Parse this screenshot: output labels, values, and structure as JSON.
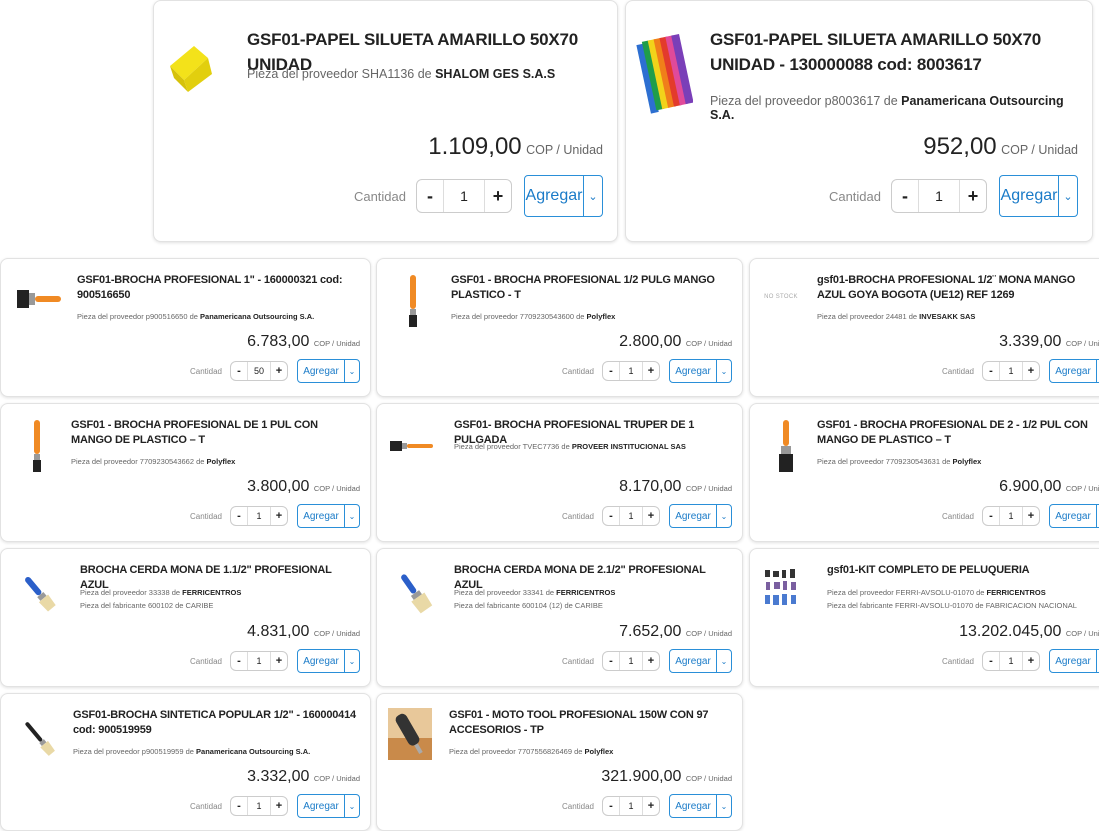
{
  "products": [
    {
      "title": "GSF01-PAPEL SILUETA AMARILLO 50X70 UNIDAD",
      "supplier_prefix": "Pieza del proveedor SHA1136 de ",
      "supplier_name": "SHALOM GES S.A.S",
      "price": "1.109,00",
      "unit": "COP / Unidad",
      "qty_label": "Cantidad",
      "quantity": "1",
      "add_label": "Agregar",
      "icon": "yellow-paper-icon"
    },
    {
      "title": "GSF01-PAPEL SILUETA AMARILLO 50X70 UNIDAD - 130000088 cod: 8003617",
      "supplier_prefix": "Pieza del proveedor p8003617 de ",
      "supplier_name": "Panamericana Outsourcing S.A.",
      "price": "952,00",
      "unit": "COP / Unidad",
      "qty_label": "Cantidad",
      "quantity": "1",
      "add_label": "Agregar",
      "icon": "colored-paper-stack-icon"
    },
    {
      "title": "GSF01-BROCHA PROFESIONAL 1\" - 160000321 cod: 900516650",
      "supplier_prefix": "Pieza del proveedor p900516650 de ",
      "supplier_name": "Panamericana Outsourcing S.A.",
      "price": "6.783,00",
      "unit": "COP / Unidad",
      "qty_label": "Cantidad",
      "quantity": "50",
      "add_label": "Agregar",
      "icon": "paintbrush-icon"
    },
    {
      "title": "GSF01 - BROCHA PROFESIONAL 1/2 PULG MANGO PLASTICO - T",
      "supplier_prefix": "Pieza del proveedor 7709230543600 de ",
      "supplier_name": "Polyflex",
      "price": "2.800,00",
      "unit": "COP / Unidad",
      "qty_label": "Cantidad",
      "quantity": "1",
      "add_label": "Agregar",
      "icon": "paintbrush-icon"
    },
    {
      "title": "gsf01-BROCHA PROFESIONAL 1/2¨ MONA MANGO AZUL GOYA BOGOTA (UE12) REF 1269",
      "supplier_prefix": "Pieza del proveedor 24481 de ",
      "supplier_name": "INVESAKK SAS",
      "price": "3.339,00",
      "unit": "COP / Unidad",
      "qty_label": "Cantidad",
      "quantity": "1",
      "add_label": "Agregar",
      "no_stock": "NO STOCK",
      "icon": "no-stock-icon"
    },
    {
      "title": "GSF01 - BROCHA PROFESIONAL DE 1 PUL CON MANGO DE PLASTICO – T",
      "supplier_prefix": "Pieza del proveedor 7709230543662 de ",
      "supplier_name": "Polyflex",
      "price": "3.800,00",
      "unit": "COP / Unidad",
      "qty_label": "Cantidad",
      "quantity": "1",
      "add_label": "Agregar",
      "icon": "paintbrush-icon"
    },
    {
      "title": "GSF01- BROCHA PROFESIONAL TRUPER DE 1 PULGADA",
      "supplier_prefix": "Pieza del proveedor TVEC7736 de ",
      "supplier_name": "PROVEER INSTITUCIONAL SAS",
      "price": "8.170,00",
      "unit": "COP / Unidad",
      "qty_label": "Cantidad",
      "quantity": "1",
      "add_label": "Agregar",
      "icon": "paintbrush-icon"
    },
    {
      "title": "GSF01 - BROCHA PROFESIONAL DE 2 - 1/2 PUL CON MANGO DE PLASTICO – T",
      "supplier_prefix": "Pieza del proveedor 7709230543631 de ",
      "supplier_name": "Polyflex",
      "price": "6.900,00",
      "unit": "COP / Unidad",
      "qty_label": "Cantidad",
      "quantity": "1",
      "add_label": "Agregar",
      "icon": "paintbrush-icon"
    },
    {
      "title": "BROCHA CERDA MONA DE 1.1/2\" PROFESIONAL AZUL",
      "supplier_prefix": "Pieza del proveedor 33338 de ",
      "supplier_name": "FERRICENTROS",
      "manufacturer": "Pieza del fabricante 600102 de CARIBE",
      "price": "4.831,00",
      "unit": "COP / Unidad",
      "qty_label": "Cantidad",
      "quantity": "1",
      "add_label": "Agregar",
      "icon": "paintbrush-icon"
    },
    {
      "title": "BROCHA CERDA MONA DE 2.1/2\" PROFESIONAL AZUL",
      "supplier_prefix": "Pieza del proveedor 33341 de ",
      "supplier_name": "FERRICENTROS",
      "manufacturer": "Pieza del fabricante 600104 (12) de CARIBE",
      "price": "7.652,00",
      "unit": "COP / Unidad",
      "qty_label": "Cantidad",
      "quantity": "1",
      "add_label": "Agregar",
      "icon": "paintbrush-icon"
    },
    {
      "title": "gsf01-KIT COMPLETO DE PELUQUERIA",
      "supplier_prefix": "Pieza del proveedor FERRI-AVSOLU-01070 de ",
      "supplier_name": "FERRICENTROS",
      "manufacturer": "Pieza del fabricante FERRI-AVSOLU-01070 de FABRICACION NACIONAL",
      "price": "13.202.045,00",
      "unit": "COP / Unidad",
      "qty_label": "Cantidad",
      "quantity": "1",
      "add_label": "Agregar",
      "icon": "hairdressing-kit-icon"
    },
    {
      "title": "GSF01-BROCHA SINTETICA POPULAR 1/2\" - 160000414 cod: 900519959",
      "supplier_prefix": "Pieza del proveedor p900519959 de ",
      "supplier_name": "Panamericana Outsourcing S.A.",
      "price": "3.332,00",
      "unit": "COP / Unidad",
      "qty_label": "Cantidad",
      "quantity": "1",
      "add_label": "Agregar",
      "icon": "paintbrush-icon"
    },
    {
      "title": "GSF01 - MOTO TOOL PROFESIONAL 150W CON 97 ACCESORIOS - TP",
      "supplier_prefix": "Pieza del proveedor 7707556826469 de ",
      "supplier_name": "Polyflex",
      "price": "321.900,00",
      "unit": "COP / Unidad",
      "qty_label": "Cantidad",
      "quantity": "1",
      "add_label": "Agregar",
      "icon": "rotary-tool-icon"
    }
  ],
  "colors": {
    "accent": "#2a8fd8",
    "brush_handle": "#f08a24",
    "paper_yellow": "#f3e21a"
  }
}
